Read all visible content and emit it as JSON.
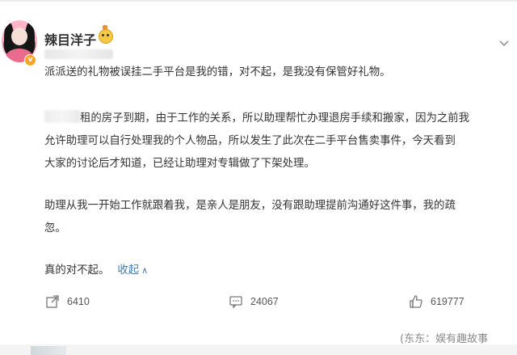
{
  "author": {
    "name": "辣目洋子"
  },
  "post": {
    "paragraph1": "派派送的礼物被误挂二手平台是我的错，对不起，是我没有保管好礼物。",
    "paragraph2_a": "租的房子到期，由于工作的关系，所以助理帮忙办理退房手续和搬家，因为之前我",
    "paragraph2_b": "允许助理可以自行处理我的个人物品，所以发生了此次在二手平台售卖事件，今天看到",
    "paragraph2_c": "大家的讨论后才知道，已经让助理对专辑做了下架处理。",
    "paragraph3_a": "助理从我一开始工作就跟着我，是亲人是朋友，没有跟助理提前沟通好这件事，我的疏",
    "paragraph3_b": "忽。",
    "paragraph4": "真的对不起。",
    "collapse_label": "收起"
  },
  "actions": {
    "share_count": "6410",
    "comment_count": "24067",
    "like_count": "619777"
  },
  "watermark": "(东东：娱有趣故事",
  "colors": {
    "link": "#4a78a8",
    "text": "#333333",
    "verified": "#f6a623"
  },
  "icons": [
    "share-icon",
    "comment-icon",
    "like-icon",
    "chevron-down-icon",
    "verified-icon"
  ]
}
